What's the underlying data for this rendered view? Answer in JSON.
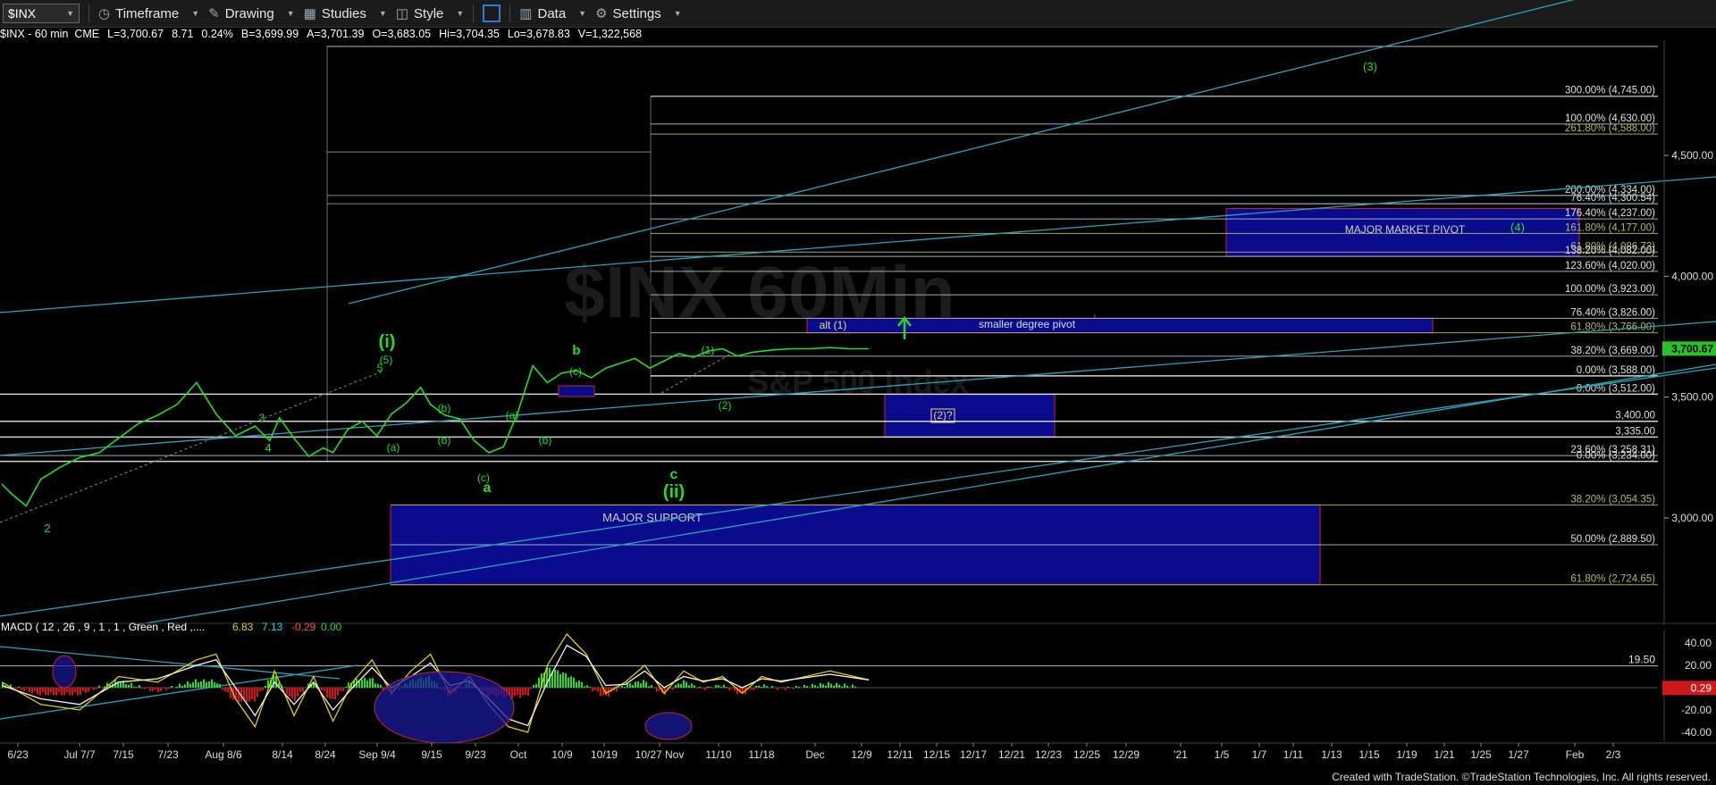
{
  "toolbar": {
    "symbol": "$INX",
    "items": [
      {
        "label": "Timeframe",
        "icon": "clock-icon"
      },
      {
        "label": "Drawing",
        "icon": "pencil-icon"
      },
      {
        "label": "Studies",
        "icon": "studies-icon"
      },
      {
        "label": "Style",
        "icon": "palette-icon"
      },
      {
        "label": "Data",
        "icon": "data-icon"
      },
      {
        "label": "Settings",
        "icon": "gear-icon"
      }
    ]
  },
  "infobar": {
    "title": "$INX - 60 min  CME",
    "last": "L=3,700.67",
    "change": "8.71",
    "pct": "0.24%",
    "bid": "B=3,699.99",
    "ask": "A=3,701.39",
    "open": "O=3,683.05",
    "high": "Hi=3,704.35",
    "low": "Lo=3,678.83",
    "volume": "V=1,322,568"
  },
  "watermark": "$INX 60Min",
  "watermark2": "S&P 500 Index",
  "footer": "Created with TradeStation. ©TradeStation Technologies, Inc. All rights reserved.",
  "colors": {
    "price": "#22dd22",
    "channel": "#2aa3b8",
    "box_fill": "#0a0a8c",
    "box_border": "#cc2233",
    "fib_yellow": "#b7b76a",
    "last_tag": "#2bbf2b",
    "macd_tag": "#cc1a1a"
  },
  "chart_data": [
    {
      "type": "line",
      "symbol": "$INX",
      "interval": "60 min",
      "y_tick_labels": [
        "4,500.00",
        "4,000.00",
        "3,500.00",
        "3,000.00"
      ],
      "ylim": [
        2640,
        5000
      ],
      "x_tick_labels": [
        "6/23",
        "Jul 7/7",
        "7/15",
        "7/23",
        "Aug 8/6",
        "8/14",
        "8/24",
        "Sep 9/4",
        "9/15",
        "9/23",
        "Oct",
        "10/9",
        "10/19",
        "10/27 Nov",
        "11/10",
        "11/18",
        "Dec",
        "12/9",
        "12/11",
        "12/15",
        "12/17",
        "12/21",
        "12/23",
        "12/25",
        "12/29",
        "'21",
        "1/5",
        "1/7",
        "1/11",
        "1/13",
        "1/15",
        "1/19",
        "1/21",
        "1/25",
        "1/27",
        "Feb",
        "2/3"
      ],
      "last_value": "3,700.67",
      "series": [
        {
          "x": [
            0,
            2,
            5,
            8,
            12,
            16,
            20,
            24,
            28,
            32,
            36,
            40,
            44,
            48,
            52,
            55,
            57,
            60,
            63,
            66,
            68,
            71,
            74,
            77,
            80,
            83,
            86,
            88,
            91,
            94,
            97,
            100,
            103,
            106,
            109,
            112,
            115,
            118,
            121,
            124,
            127,
            130,
            133,
            136,
            139,
            142,
            145,
            148,
            151,
            154,
            158,
            162,
            166,
            170,
            174,
            178
          ],
          "values": [
            3140,
            3100,
            3050,
            3160,
            3210,
            3250,
            3270,
            3330,
            3390,
            3425,
            3470,
            3560,
            3430,
            3340,
            3380,
            3320,
            3415,
            3330,
            3255,
            3290,
            3270,
            3365,
            3400,
            3340,
            3430,
            3475,
            3540,
            3470,
            3425,
            3410,
            3320,
            3270,
            3295,
            3440,
            3630,
            3560,
            3600,
            3610,
            3580,
            3620,
            3640,
            3660,
            3620,
            3650,
            3680,
            3665,
            3690,
            3700,
            3670,
            3685,
            3695,
            3700,
            3700,
            3705,
            3700,
            3700
          ]
        }
      ],
      "fib_levels": [
        {
          "label": "300.00% (4,745.00)",
          "value": 4745
        },
        {
          "label": "100.00% (4,630.00)",
          "value": 4630
        },
        {
          "label": "261.80% (4,588.00)",
          "value": 4588
        },
        {
          "label": "200.00% (4,334.00)",
          "value": 4334
        },
        {
          "label": "76.40% (4,300.54)",
          "value": 4300
        },
        {
          "label": "176.40% (4,237.00)",
          "value": 4237
        },
        {
          "label": "161.80% (4,177.00)",
          "value": 4177
        },
        {
          "label": "61.80% (4,086.73)",
          "value": 4100
        },
        {
          "label": "138.20% (4,082.00)",
          "value": 4082
        },
        {
          "label": "123.60% (4,020.00)",
          "value": 4020
        },
        {
          "label": "100.00% (3,923.00)",
          "value": 3923
        },
        {
          "label": "76.40% (3,826.00)",
          "value": 3826
        },
        {
          "label": "61.80% (3,766.00)",
          "value": 3766
        },
        {
          "label": "38.20% (3,669.00)",
          "value": 3669
        },
        {
          "label": "0.00% (3,588.00)",
          "value": 3588
        },
        {
          "label": "0.00% (3,512.00)",
          "value": 3512
        },
        {
          "label": "3,400.00",
          "value": 3400
        },
        {
          "label": "3,335.00",
          "value": 3335
        },
        {
          "label": "23.60% (3,258.31)",
          "value": 3258
        },
        {
          "label": "0.00% (3,234.00)",
          "value": 3234
        },
        {
          "label": "38.20% (3,054.35)",
          "value": 3054
        },
        {
          "label": "50.00% (2,889.50)",
          "value": 2889
        },
        {
          "label": "61.80% (2,724.65)",
          "value": 2724
        }
      ],
      "zones": [
        {
          "label": "MAJOR MARKET PIVOT",
          "from": 4082,
          "to": 4280
        },
        {
          "label": "smaller degree pivot",
          "from": 3766,
          "to": 3826
        },
        {
          "label": "alt (1)",
          "from": 3766,
          "to": 3826
        },
        {
          "label": "(2)?",
          "from": 3335,
          "to": 3512
        },
        {
          "label": "MAJOR SUPPORT",
          "from": 2724,
          "to": 3054
        }
      ],
      "wave_labels": [
        "(3)",
        "(4)",
        "(i)",
        "(5)",
        "b",
        "(c)",
        "(1)",
        "(2)",
        "(a)",
        "(b)",
        "(c)",
        "a",
        "c",
        "(ii)",
        "2",
        "3",
        "4",
        "5"
      ]
    },
    {
      "type": "line",
      "title": "MACD ( 12 , 26 , 9 , 1 , 1 , Green , Red ,....",
      "values_shown": [
        "6.83",
        "7.13",
        "-0.29",
        "0.00"
      ],
      "y_tick_labels": [
        "40.00",
        "20.00",
        "19.50",
        "0.29",
        "-20.00",
        "-40.00"
      ],
      "ylim": [
        -45,
        50
      ],
      "series": [
        {
          "name": "MACD",
          "x": [
            0,
            8,
            16,
            24,
            32,
            40,
            44,
            48,
            52,
            56,
            60,
            64,
            68,
            72,
            76,
            80,
            84,
            88,
            92,
            96,
            100,
            104,
            108,
            112,
            116,
            120,
            124,
            128,
            132,
            136,
            140,
            144,
            148,
            152,
            156,
            160,
            170,
            178
          ],
          "values": [
            5,
            -15,
            -20,
            10,
            5,
            25,
            30,
            -10,
            -35,
            15,
            -25,
            10,
            -30,
            5,
            25,
            -5,
            15,
            30,
            -5,
            10,
            -15,
            -35,
            -40,
            20,
            48,
            30,
            -5,
            5,
            20,
            -5,
            15,
            5,
            10,
            -5,
            10,
            5,
            15,
            7
          ]
        },
        {
          "name": "Signal",
          "x": [
            0,
            8,
            16,
            24,
            32,
            40,
            44,
            48,
            52,
            56,
            60,
            64,
            68,
            72,
            76,
            80,
            84,
            88,
            92,
            96,
            100,
            104,
            108,
            112,
            116,
            120,
            124,
            128,
            132,
            136,
            140,
            144,
            148,
            152,
            156,
            160,
            170,
            178
          ],
          "values": [
            2,
            -10,
            -15,
            5,
            8,
            20,
            25,
            0,
            -25,
            5,
            -15,
            5,
            -20,
            0,
            18,
            0,
            10,
            22,
            2,
            6,
            -10,
            -28,
            -34,
            5,
            38,
            28,
            2,
            3,
            15,
            0,
            10,
            6,
            8,
            0,
            8,
            6,
            12,
            7
          ]
        }
      ]
    }
  ]
}
